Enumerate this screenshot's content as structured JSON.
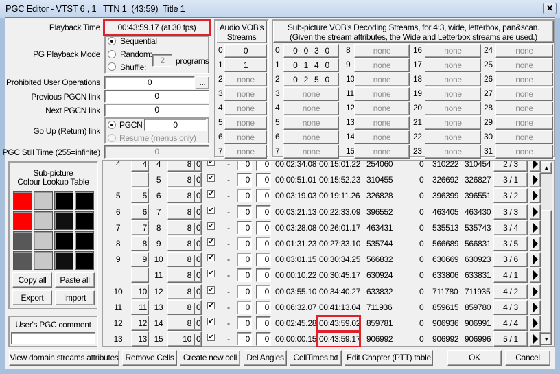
{
  "window": {
    "title": "PGC Editor - VTST 6 , 1   TTN 1  (43:59)  Title 1",
    "close": "✕"
  },
  "playback": {
    "label": "Playback Time",
    "value": "00:43:59.17 (at 30 fps)"
  },
  "mode": {
    "label": "PG Playback Mode",
    "sequential": "Sequential",
    "random": "Random:",
    "shuffle": "Shuffle:",
    "programs_value": "2",
    "programs_label": "programs"
  },
  "prohibited": {
    "label": "Prohibited User Operations",
    "value": "0",
    "more": "..."
  },
  "prev_link": {
    "label": "Previous PGCN link",
    "value": "0"
  },
  "next_link": {
    "label": "Next PGCN link",
    "value": "0"
  },
  "goup": {
    "label": "Go Up (Return) link",
    "pgcn": "PGCN",
    "pgcn_value": "0",
    "resume": "Resume (menus only)"
  },
  "still": {
    "label": "PGC Still Time (255=infinite)",
    "value": "0"
  },
  "audio": {
    "header": "Audio VOB's Streams",
    "streams": [
      {
        "n": "0",
        "v": "0"
      },
      {
        "n": "1",
        "v": "1"
      },
      {
        "n": "2",
        "v": "none"
      },
      {
        "n": "3",
        "v": "none"
      },
      {
        "n": "4",
        "v": "none"
      },
      {
        "n": "5",
        "v": "none"
      },
      {
        "n": "6",
        "v": "none"
      },
      {
        "n": "7",
        "v": "none"
      }
    ]
  },
  "subpic": {
    "header1": "Sub-picture VOB's Decoding Streams, for 4:3, wide, letterbox, pan&scan.",
    "header2": "(Given the stream attributes, the Wide and Letterbox streams are used.)",
    "streams": [
      {
        "n": "0",
        "v": "0   0   3   0"
      },
      {
        "n": "1",
        "v": "0   1   4   0"
      },
      {
        "n": "2",
        "v": "0   2   5   0"
      },
      {
        "n": "3",
        "v": "none"
      },
      {
        "n": "4",
        "v": "none"
      },
      {
        "n": "5",
        "v": "none"
      },
      {
        "n": "6",
        "v": "none"
      },
      {
        "n": "7",
        "v": "none"
      },
      {
        "n": "8",
        "v": "none"
      },
      {
        "n": "9",
        "v": "none"
      },
      {
        "n": "10",
        "v": "none"
      },
      {
        "n": "11",
        "v": "none"
      },
      {
        "n": "12",
        "v": "none"
      },
      {
        "n": "13",
        "v": "none"
      },
      {
        "n": "14",
        "v": "none"
      },
      {
        "n": "15",
        "v": "none"
      },
      {
        "n": "16",
        "v": "none"
      },
      {
        "n": "17",
        "v": "none"
      },
      {
        "n": "18",
        "v": "none"
      },
      {
        "n": "19",
        "v": "none"
      },
      {
        "n": "20",
        "v": "none"
      },
      {
        "n": "21",
        "v": "none"
      },
      {
        "n": "22",
        "v": "none"
      },
      {
        "n": "23",
        "v": "none"
      },
      {
        "n": "24",
        "v": "none"
      },
      {
        "n": "25",
        "v": "none"
      },
      {
        "n": "26",
        "v": "none"
      },
      {
        "n": "27",
        "v": "none"
      },
      {
        "n": "28",
        "v": "none"
      },
      {
        "n": "29",
        "v": "none"
      },
      {
        "n": "30",
        "v": "none"
      },
      {
        "n": "31",
        "v": "none"
      }
    ]
  },
  "clut": {
    "title1": "Sub-picture",
    "title2": "Colour Lookup Table",
    "colors": [
      "#ff0000",
      "#c8c8c8",
      "#000000",
      "#000000",
      "#ff0000",
      "#c8c8c8",
      "#101010",
      "#000000",
      "#585858",
      "#c8c8c8",
      "#000000",
      "#000000",
      "#585858",
      "#c8c8c8",
      "#101010",
      "#000000"
    ],
    "copy": "Copy all",
    "paste": "Paste all",
    "export": "Export",
    "import": "Import"
  },
  "comment": {
    "label": "User's PGC comment",
    "value": ""
  },
  "cells": [
    {
      "pg": "4",
      "pgb": "4",
      "cell": "4",
      "a": "8",
      "b": "0",
      "c1": "0",
      "c2": "0",
      "len": "00:02:34.08",
      "end": "00:15:01.22",
      "s1": "254060",
      "z": "0",
      "s2": "310222",
      "s3": "310454",
      "ch": "2 / 3"
    },
    {
      "pg": "",
      "pgb": "",
      "cell": "5",
      "a": "8",
      "b": "0",
      "c1": "0",
      "c2": "0",
      "len": "00:00:51.01",
      "end": "00:15:52.23",
      "s1": "310455",
      "z": "0",
      "s2": "326692",
      "s3": "326827",
      "ch": "3 / 1"
    },
    {
      "pg": "5",
      "pgb": "5",
      "cell": "6",
      "a": "8",
      "b": "0",
      "c1": "0",
      "c2": "0",
      "len": "00:03:19.03",
      "end": "00:19:11.26",
      "s1": "326828",
      "z": "0",
      "s2": "396399",
      "s3": "396551",
      "ch": "3 / 2"
    },
    {
      "pg": "6",
      "pgb": "6",
      "cell": "7",
      "a": "8",
      "b": "0",
      "c1": "0",
      "c2": "0",
      "len": "00:03:21.13",
      "end": "00:22:33.09",
      "s1": "396552",
      "z": "0",
      "s2": "463405",
      "s3": "463430",
      "ch": "3 / 3"
    },
    {
      "pg": "7",
      "pgb": "7",
      "cell": "8",
      "a": "8",
      "b": "0",
      "c1": "0",
      "c2": "0",
      "len": "00:03:28.08",
      "end": "00:26:01.17",
      "s1": "463431",
      "z": "0",
      "s2": "535513",
      "s3": "535743",
      "ch": "3 / 4"
    },
    {
      "pg": "8",
      "pgb": "8",
      "cell": "9",
      "a": "8",
      "b": "0",
      "c1": "0",
      "c2": "0",
      "len": "00:01:31.23",
      "end": "00:27:33.10",
      "s1": "535744",
      "z": "0",
      "s2": "566689",
      "s3": "566831",
      "ch": "3 / 5"
    },
    {
      "pg": "9",
      "pgb": "9",
      "cell": "10",
      "a": "8",
      "b": "0",
      "c1": "0",
      "c2": "0",
      "len": "00:03:01.15",
      "end": "00:30:34.25",
      "s1": "566832",
      "z": "0",
      "s2": "630669",
      "s3": "630923",
      "ch": "3 / 6"
    },
    {
      "pg": "",
      "pgb": "",
      "cell": "11",
      "a": "8",
      "b": "0",
      "c1": "0",
      "c2": "0",
      "len": "00:00:10.22",
      "end": "00:30:45.17",
      "s1": "630924",
      "z": "0",
      "s2": "633806",
      "s3": "633831",
      "ch": "4 / 1"
    },
    {
      "pg": "10",
      "pgb": "10",
      "cell": "12",
      "a": "8",
      "b": "0",
      "c1": "0",
      "c2": "0",
      "len": "00:03:55.10",
      "end": "00:34:40.27",
      "s1": "633832",
      "z": "0",
      "s2": "711780",
      "s3": "711935",
      "ch": "4 / 2"
    },
    {
      "pg": "11",
      "pgb": "11",
      "cell": "13",
      "a": "8",
      "b": "0",
      "c1": "0",
      "c2": "0",
      "len": "00:06:32.07",
      "end": "00:41:13.04",
      "s1": "711936",
      "z": "0",
      "s2": "859615",
      "s3": "859780",
      "ch": "4 / 3"
    },
    {
      "pg": "12",
      "pgb": "12",
      "cell": "14",
      "a": "8",
      "b": "0",
      "c1": "0",
      "c2": "0",
      "len": "00:02:45.28",
      "end": "00:43:59.02",
      "s1": "859781",
      "z": "0",
      "s2": "906936",
      "s3": "906991",
      "ch": "4 / 4",
      "hl": true
    },
    {
      "pg": "13",
      "pgb": "13",
      "cell": "15",
      "a": "10",
      "b": "0",
      "c1": "0",
      "c2": "0",
      "len": "00:00:00.15",
      "end": "00:43:59.17",
      "s1": "906992",
      "z": "0",
      "s2": "906992",
      "s3": "906996",
      "ch": "5 / 1",
      "hl": true
    }
  ],
  "dash": "-",
  "check": "✔",
  "buttons": {
    "view": "View domain streams attributes",
    "remove": "Remove Cells",
    "create": "Create new cell",
    "del": "Del Angles",
    "celltimes": "CellTimes.txt",
    "edit": "Edit Chapter (PTT) table",
    "ok": "OK",
    "cancel": "Cancel"
  },
  "highlight_color": "#e0202a"
}
